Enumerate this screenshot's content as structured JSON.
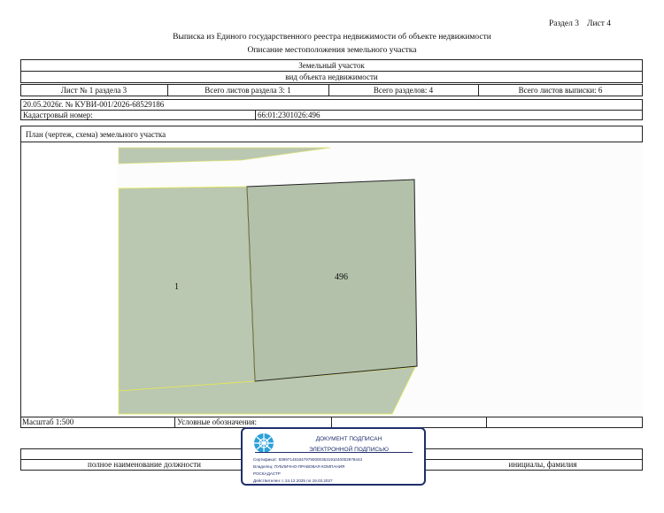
{
  "header": {
    "section": "Раздел 3",
    "sheet": "Лист 4",
    "title": "Выписка из Единого государственного реестра недвижимости об объекте недвижимости",
    "subtitle": "Описание местоположения земельного участка"
  },
  "object": {
    "type": "Земельный участок",
    "type_caption": "вид объекта недвижимости"
  },
  "sheet_info": {
    "sheet_no": "Лист № 1 раздела 3",
    "total_sheets_section": "Всего листов раздела 3: 1",
    "total_sections": "Всего разделов: 4",
    "total_sheets_extract": "Всего листов выписки: 6"
  },
  "doc_id": "20.05.2026г. № КУВИ-001/2026-68529186",
  "cadastral": {
    "label": "Кадастровый номер:",
    "value": "66:01:2301026:496"
  },
  "plan": {
    "title": "План (чертеж, схема) земельного участка",
    "parcel_labels": [
      "1",
      "496"
    ]
  },
  "footer": {
    "scale": "Масштаб 1:500",
    "legend_label": "Условные обозначения:",
    "position_caption": "полное наименование должности",
    "name_caption": "инициалы, фамилия"
  },
  "stamp": {
    "line1": "ДОКУМЕНТ ПОДПИСАН",
    "line2": "ЭЛЕКТРОННОЙ ПОДПИСЬЮ",
    "certificate": "Сертификат: 8399714818479790000353191040002978443",
    "owner_line1": "Владелец: ПУБЛИЧНО-ПРАВОВАЯ КОМПАНИЯ",
    "owner_line2": "РОСКАДАСТР",
    "valid": "Действителен: с 24.12.2025 по 19.03.2027"
  },
  "colors": {
    "parcel_fill": "#bac7b1",
    "parcel_border_yellow": "#e6ea55",
    "stamp_blue": "#1f2d6b",
    "stamp_logo_blue": "#2aa0d8"
  }
}
